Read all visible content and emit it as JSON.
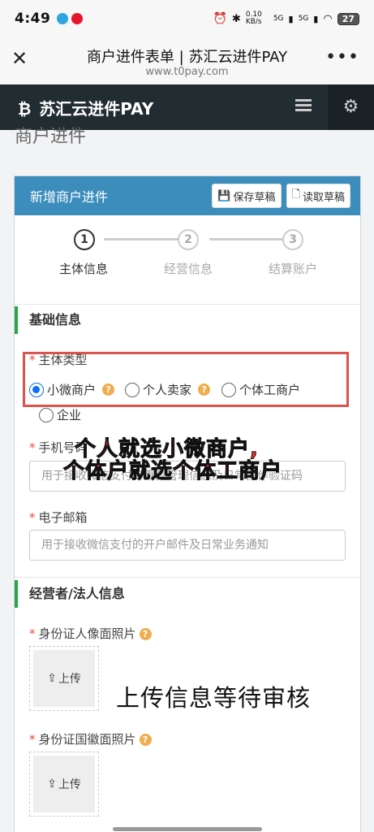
{
  "status": {
    "time": "4:49",
    "net_speed": "0.10 KB/s",
    "signal1": "5G",
    "signal2": "5G",
    "battery": "27"
  },
  "browser": {
    "title": "商户进件表单 | 苏汇云进件PAY",
    "url": "www.t0pay.com"
  },
  "app": {
    "brand": "苏汇云进件PAY"
  },
  "page": {
    "heading": "商户进件"
  },
  "card": {
    "title": "新增商户进件",
    "save_draft": "保存草稿",
    "load_draft": "读取草稿"
  },
  "steps": [
    {
      "num": "1",
      "label": "主体信息"
    },
    {
      "num": "2",
      "label": "经营信息"
    },
    {
      "num": "3",
      "label": "结算账户"
    }
  ],
  "basic": {
    "title": "基础信息",
    "entity_label": "主体类型",
    "entity_options": [
      "小微商户",
      "个人卖家",
      "个体工商户",
      "企业"
    ],
    "phone_label": "手机号码",
    "phone_placeholder": "用于接收微信支付的重要管理信息及日常操作验证码",
    "email_label": "电子邮箱",
    "email_placeholder": "用于接收微信支付的开户邮件及日常业务通知"
  },
  "legal": {
    "title": "经营者/法人信息",
    "id_front_label": "身份证人像面照片",
    "id_back_label": "身份证国徽面照片",
    "upload_label": "上传"
  },
  "annotations": {
    "line1": "个人就选小微商户,",
    "line2": "个体户就选个体工商户",
    "bottom": "上传信息等待审核"
  }
}
